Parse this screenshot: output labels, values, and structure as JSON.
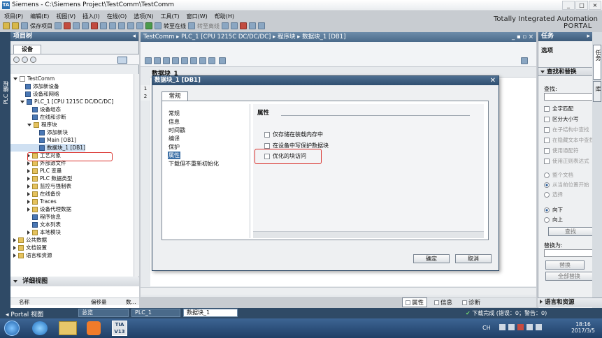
{
  "window": {
    "title": "Siemens - C:\\Siemens Project\\TestComm\\TestComm",
    "controls": [
      "_",
      "□",
      "×"
    ]
  },
  "menu": [
    "项目(P)",
    "编辑(E)",
    "视图(V)",
    "插入(I)",
    "在线(O)",
    "选项(N)",
    "工具(T)",
    "窗口(W)",
    "帮助(H)"
  ],
  "toolbar": {
    "save_label": "保存项目",
    "online_label": "转至在线",
    "offline_label": "转至离线"
  },
  "brand": {
    "line1": "Totally Integrated Automation",
    "line2": "PORTAL"
  },
  "left_tab": "PLC 编程",
  "project_tree": {
    "header": "项目树",
    "devices_tab": "设备",
    "items": [
      {
        "label": "TestComm",
        "level": 0,
        "icon": "doc"
      },
      {
        "label": "添加新设备",
        "level": 1,
        "icon": "blk"
      },
      {
        "label": "设备和网络",
        "level": 1,
        "icon": "blk"
      },
      {
        "label": "PLC_1 [CPU 1215C DC/DC/DC]",
        "level": 1,
        "icon": "blk"
      },
      {
        "label": "设备组态",
        "level": 2,
        "icon": "blk"
      },
      {
        "label": "在线和诊断",
        "level": 2,
        "icon": "blk"
      },
      {
        "label": "程序块",
        "level": 2,
        "icon": "fld"
      },
      {
        "label": "添加新块",
        "level": 3,
        "icon": "blk"
      },
      {
        "label": "Main [OB1]",
        "level": 3,
        "icon": "blk"
      },
      {
        "label": "数据块_1 [DB1]",
        "level": 3,
        "icon": "blk"
      },
      {
        "label": "工艺对象",
        "level": 2,
        "icon": "fld"
      },
      {
        "label": "外部源文件",
        "level": 2,
        "icon": "fld"
      },
      {
        "label": "PLC 变量",
        "level": 2,
        "icon": "fld"
      },
      {
        "label": "PLC 数据类型",
        "level": 2,
        "icon": "fld"
      },
      {
        "label": "监控与强制表",
        "level": 2,
        "icon": "fld"
      },
      {
        "label": "在线备份",
        "level": 2,
        "icon": "fld"
      },
      {
        "label": "Traces",
        "level": 2,
        "icon": "fld"
      },
      {
        "label": "设备代理数据",
        "level": 2,
        "icon": "fld"
      },
      {
        "label": "程序信息",
        "level": 2,
        "icon": "blk"
      },
      {
        "label": "文本列表",
        "level": 2,
        "icon": "blk"
      },
      {
        "label": "本地模块",
        "level": 2,
        "icon": "fld"
      },
      {
        "label": "公共数据",
        "level": 0,
        "icon": "fld"
      },
      {
        "label": "文档设置",
        "level": 0,
        "icon": "fld"
      },
      {
        "label": "语言和资源",
        "level": 0,
        "icon": "fld"
      }
    ]
  },
  "details_view": {
    "header": "详细视图",
    "col_name": "名称",
    "col_offset": "偏移量",
    "col_num": "数..."
  },
  "editor": {
    "breadcrumb": "TestComm ▸ PLC_1 [CPU 1215C DC/DC/DC] ▸ 程序块 ▸ 数据块_1 [DB1]",
    "block_title": "数据块_1",
    "row_numbers": [
      "1",
      "2"
    ]
  },
  "dialog": {
    "title": "数据块_1 [DB1]",
    "tab": "常规",
    "nav": [
      "常规",
      "信息",
      "时间戳",
      "编译",
      "保护",
      "属性",
      "下载但不重新初始化"
    ],
    "selected_nav": "属性",
    "section": "属性",
    "options": [
      {
        "label": "仅存储在装载内存中",
        "checked": false
      },
      {
        "label": "在设备中写保护数据块",
        "checked": false
      },
      {
        "label": "优化的块访问",
        "checked": false
      }
    ],
    "ok": "确定",
    "cancel": "取消"
  },
  "inspector": {
    "tabs": [
      "属性",
      "信息",
      "诊断"
    ]
  },
  "tasks": {
    "header": "任务",
    "options_label": "选项",
    "find_replace": "查找和替换",
    "find_label": "查找:",
    "checks": [
      {
        "label": "全字匹配",
        "enabled": true
      },
      {
        "label": "区分大小写",
        "enabled": true
      },
      {
        "label": "在子结构中查找",
        "enabled": false
      },
      {
        "label": "在隐藏文本中查找",
        "enabled": false
      },
      {
        "label": "使用通配符",
        "enabled": false
      },
      {
        "label": "使用正则表达式",
        "enabled": false
      }
    ],
    "radios": [
      {
        "label": "整个文档",
        "enabled": false,
        "selected": false
      },
      {
        "label": "从当前位置开始",
        "enabled": false,
        "selected": true
      },
      {
        "label": "选择",
        "enabled": false,
        "selected": false
      },
      {
        "label": "向下",
        "enabled": true,
        "selected": true
      },
      {
        "label": "向上",
        "enabled": true,
        "selected": false
      }
    ],
    "find_btn": "查找",
    "replace_label": "替换为:",
    "replace_btn": "替换",
    "replace_all_btn": "全部替换",
    "side_tabs": [
      "任务",
      "库"
    ],
    "lang_res": "语言和资源"
  },
  "bottom": {
    "portal_view": "Portal 视图",
    "tabs": [
      "总览",
      "PLC_1",
      "数据块_1"
    ],
    "status": "下载完成 (错误：0；警告：0)"
  },
  "taskbar": {
    "lang": "CH",
    "time": "18:16",
    "date": "2017/3/5"
  }
}
